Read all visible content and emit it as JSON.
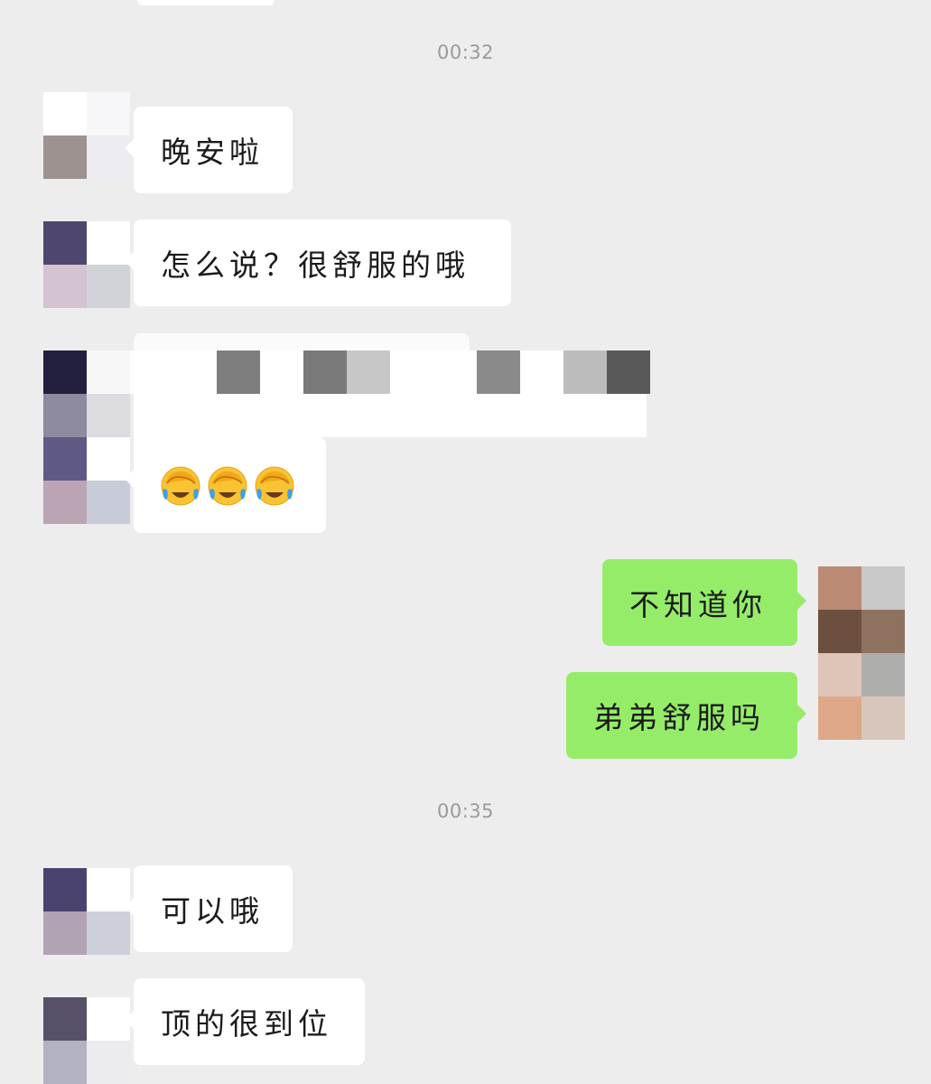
{
  "chat": {
    "timestamps": [
      "00:32",
      "00:35"
    ],
    "messages": {
      "m1": "晚安啦",
      "m2": "怎么说？很舒服的哦",
      "m5": "不知道你",
      "m6": "弟弟舒服吗",
      "m7": "可以哦",
      "m8": "顶的很到位"
    },
    "emoji": [
      "face-palm-crying",
      "face-palm-crying",
      "face-palm-crying"
    ]
  },
  "colors": {
    "background": "#ededed",
    "incoming_bubble": "#ffffff",
    "outgoing_bubble": "#95ec69",
    "timestamp": "#9a9a9a"
  }
}
